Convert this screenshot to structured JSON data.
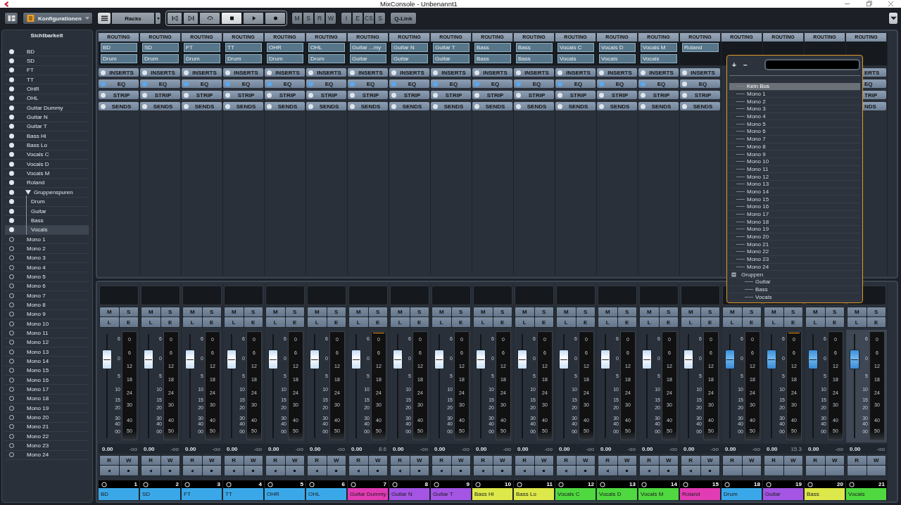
{
  "window": {
    "title": "MixConsole - Unbenannt1"
  },
  "toolbar": {
    "config_label": "Konfigurationen",
    "racks_label": "Racks",
    "qlink": "Q-Link",
    "transport": [
      {
        "kind": "start",
        "selected": false
      },
      {
        "kind": "end",
        "selected": false
      },
      {
        "kind": "cycle",
        "selected": false
      },
      {
        "kind": "stop",
        "selected": true
      },
      {
        "kind": "play",
        "selected": false
      },
      {
        "kind": "record",
        "selected": false
      }
    ],
    "group_1": [
      "M",
      "S",
      "R",
      "W"
    ],
    "group_2": [
      "I",
      "E",
      "CS",
      "S"
    ]
  },
  "visibility": {
    "title": "Sichtbarkeit",
    "items": [
      {
        "label": "BD",
        "visible": true,
        "selected": false
      },
      {
        "label": "SD",
        "visible": true,
        "selected": false
      },
      {
        "label": "FT",
        "visible": true,
        "selected": false
      },
      {
        "label": "TT",
        "visible": true,
        "selected": false
      },
      {
        "label": "OHR",
        "visible": true,
        "selected": false
      },
      {
        "label": "OHL",
        "visible": true,
        "selected": false
      },
      {
        "label": "Guitar Dummy",
        "visible": true,
        "selected": false
      },
      {
        "label": "Guitar N",
        "visible": true,
        "selected": false
      },
      {
        "label": "Guitar T",
        "visible": true,
        "selected": false
      },
      {
        "label": "Bass Hi",
        "visible": true,
        "selected": false
      },
      {
        "label": "Bass Lo",
        "visible": true,
        "selected": false
      },
      {
        "label": "Vocals C",
        "visible": true,
        "selected": false
      },
      {
        "label": "Vocals D",
        "visible": true,
        "selected": false
      },
      {
        "label": "Vocals M",
        "visible": true,
        "selected": false
      },
      {
        "label": "Roland",
        "visible": true,
        "selected": false
      },
      {
        "label": "Gruppenspuren",
        "visible": true,
        "selected": false,
        "expanded": true,
        "children": [
          {
            "label": "Drum",
            "visible": true,
            "selected": false
          },
          {
            "label": "Guitar",
            "visible": true,
            "selected": false
          },
          {
            "label": "Bass",
            "visible": true,
            "selected": false
          },
          {
            "label": "Vocals",
            "visible": true,
            "selected": true
          }
        ]
      },
      {
        "label": "Mono 1",
        "visible": false,
        "selected": false
      },
      {
        "label": "Mono 2",
        "visible": false,
        "selected": false
      },
      {
        "label": "Mono 3",
        "visible": false,
        "selected": false
      },
      {
        "label": "Mono 4",
        "visible": false,
        "selected": false
      },
      {
        "label": "Mono 5",
        "visible": false,
        "selected": false
      },
      {
        "label": "Mono 6",
        "visible": false,
        "selected": false
      },
      {
        "label": "Mono 7",
        "visible": false,
        "selected": false
      },
      {
        "label": "Mono 8",
        "visible": false,
        "selected": false
      },
      {
        "label": "Mono 9",
        "visible": false,
        "selected": false
      },
      {
        "label": "Mono 10",
        "visible": false,
        "selected": false
      },
      {
        "label": "Mono 11",
        "visible": false,
        "selected": false
      },
      {
        "label": "Mono 12",
        "visible": false,
        "selected": false
      },
      {
        "label": "Mono 13",
        "visible": false,
        "selected": false
      },
      {
        "label": "Mono 14",
        "visible": false,
        "selected": false
      },
      {
        "label": "Mono 15",
        "visible": false,
        "selected": false
      },
      {
        "label": "Mono 16",
        "visible": false,
        "selected": false
      },
      {
        "label": "Mono 17",
        "visible": false,
        "selected": false
      },
      {
        "label": "Mono 18",
        "visible": false,
        "selected": false
      },
      {
        "label": "Mono 19",
        "visible": false,
        "selected": false
      },
      {
        "label": "Mono 20",
        "visible": false,
        "selected": false
      },
      {
        "label": "Mono 21",
        "visible": false,
        "selected": false
      },
      {
        "label": "Mono 22",
        "visible": false,
        "selected": false
      },
      {
        "label": "Mono 23",
        "visible": false,
        "selected": false
      },
      {
        "label": "Mono 24",
        "visible": false,
        "selected": false
      }
    ]
  },
  "channels": [
    {
      "routing": "ROUTING",
      "input": "BD",
      "output": "Drum",
      "racks": [
        {
          "label": "INSERTS",
          "on": false
        },
        {
          "label": "EQ",
          "on": true
        },
        {
          "label": "STRIP",
          "on": false
        },
        {
          "label": "SENDS",
          "on": false
        }
      ],
      "kind": "audio",
      "buttons": [
        "M",
        "S",
        "L",
        "E"
      ],
      "automation": [
        "R",
        "W"
      ],
      "fader_scale": [
        "6",
        "0",
        "5",
        "10",
        "15",
        "20",
        "30",
        "40",
        "00"
      ],
      "meter_scale": [
        "0",
        "6",
        "12",
        "18",
        "24",
        "30",
        "40",
        "50"
      ],
      "level": 0.82,
      "gain": "0.00",
      "peak": "-oo",
      "peak_hold": false,
      "number": "1",
      "name": "BD",
      "color": "#3aa8e8",
      "selected": false
    },
    {
      "routing": "ROUTING",
      "input": "SD",
      "output": "Drum",
      "racks": [
        {
          "label": "INSERTS",
          "on": false
        },
        {
          "label": "EQ",
          "on": true
        },
        {
          "label": "STRIP",
          "on": false
        },
        {
          "label": "SENDS",
          "on": false
        }
      ],
      "kind": "audio",
      "buttons": [
        "M",
        "S",
        "L",
        "E"
      ],
      "automation": [
        "R",
        "W"
      ],
      "fader_scale": [
        "6",
        "0",
        "5",
        "10",
        "15",
        "20",
        "30",
        "40",
        "00"
      ],
      "meter_scale": [
        "0",
        "6",
        "12",
        "18",
        "24",
        "30",
        "40",
        "50"
      ],
      "level": 0.82,
      "gain": "0.00",
      "peak": "-oo",
      "peak_hold": false,
      "number": "2",
      "name": "SD",
      "color": "#3aa8e8",
      "selected": false
    },
    {
      "routing": "ROUTING",
      "input": "FT",
      "output": "Drum",
      "racks": [
        {
          "label": "INSERTS",
          "on": false
        },
        {
          "label": "EQ",
          "on": true
        },
        {
          "label": "STRIP",
          "on": false
        },
        {
          "label": "SENDS",
          "on": false
        }
      ],
      "kind": "audio",
      "buttons": [
        "M",
        "S",
        "L",
        "E"
      ],
      "automation": [
        "R",
        "W"
      ],
      "fader_scale": [
        "6",
        "0",
        "5",
        "10",
        "15",
        "20",
        "30",
        "40",
        "00"
      ],
      "meter_scale": [
        "0",
        "6",
        "12",
        "18",
        "24",
        "30",
        "40",
        "50"
      ],
      "level": 0.82,
      "gain": "0.00",
      "peak": "-oo",
      "peak_hold": false,
      "number": "3",
      "name": "FT",
      "color": "#3aa8e8",
      "selected": false
    },
    {
      "routing": "ROUTING",
      "input": "TT",
      "output": "Drum",
      "racks": [
        {
          "label": "INSERTS",
          "on": false
        },
        {
          "label": "EQ",
          "on": true
        },
        {
          "label": "STRIP",
          "on": false
        },
        {
          "label": "SENDS",
          "on": false
        }
      ],
      "kind": "audio",
      "buttons": [
        "M",
        "S",
        "L",
        "E"
      ],
      "automation": [
        "R",
        "W"
      ],
      "fader_scale": [
        "6",
        "0",
        "5",
        "10",
        "15",
        "20",
        "30",
        "40",
        "00"
      ],
      "meter_scale": [
        "0",
        "6",
        "12",
        "18",
        "24",
        "30",
        "40",
        "50"
      ],
      "level": 0.82,
      "gain": "0.00",
      "peak": "-oo",
      "peak_hold": false,
      "number": "4",
      "name": "TT",
      "color": "#3aa8e8",
      "selected": false
    },
    {
      "routing": "ROUTING",
      "input": "OHR",
      "output": "Drum",
      "racks": [
        {
          "label": "INSERTS",
          "on": false
        },
        {
          "label": "EQ",
          "on": true
        },
        {
          "label": "STRIP",
          "on": false
        },
        {
          "label": "SENDS",
          "on": false
        }
      ],
      "kind": "audio",
      "buttons": [
        "M",
        "S",
        "L",
        "E"
      ],
      "automation": [
        "R",
        "W"
      ],
      "fader_scale": [
        "6",
        "0",
        "5",
        "10",
        "15",
        "20",
        "30",
        "40",
        "00"
      ],
      "meter_scale": [
        "0",
        "6",
        "12",
        "18",
        "24",
        "30",
        "40",
        "50"
      ],
      "level": 0.82,
      "gain": "0.00",
      "peak": "-oo",
      "peak_hold": false,
      "number": "5",
      "name": "OHR",
      "color": "#3aa8e8",
      "selected": false
    },
    {
      "routing": "ROUTING",
      "input": "OHL",
      "output": "Drum",
      "racks": [
        {
          "label": "INSERTS",
          "on": false
        },
        {
          "label": "EQ",
          "on": true
        },
        {
          "label": "STRIP",
          "on": false
        },
        {
          "label": "SENDS",
          "on": false
        }
      ],
      "kind": "audio",
      "buttons": [
        "M",
        "S",
        "L",
        "E"
      ],
      "automation": [
        "R",
        "W"
      ],
      "fader_scale": [
        "6",
        "0",
        "5",
        "10",
        "15",
        "20",
        "30",
        "40",
        "00"
      ],
      "meter_scale": [
        "0",
        "6",
        "12",
        "18",
        "24",
        "30",
        "40",
        "50"
      ],
      "level": 0.82,
      "gain": "0.00",
      "peak": "-oo",
      "peak_hold": false,
      "number": "6",
      "name": "OHL",
      "color": "#3aa8e8",
      "selected": false
    },
    {
      "routing": "ROUTING",
      "input": "Guitar ...my",
      "output": "Guitar",
      "racks": [
        {
          "label": "INSERTS",
          "on": false
        },
        {
          "label": "EQ",
          "on": true
        },
        {
          "label": "STRIP",
          "on": false
        },
        {
          "label": "SENDS",
          "on": false
        }
      ],
      "kind": "audio",
      "buttons": [
        "M",
        "S",
        "L",
        "E"
      ],
      "automation": [
        "R",
        "W"
      ],
      "fader_scale": [
        "6",
        "0",
        "5",
        "10",
        "15",
        "20",
        "30",
        "40",
        "00"
      ],
      "meter_scale": [
        "0",
        "6",
        "12",
        "18",
        "24",
        "30",
        "40",
        "50"
      ],
      "level": 0.82,
      "gain": "0.00",
      "peak": "8.6",
      "peak_hold": true,
      "number": "7",
      "name": "Guitar Dummy",
      "color": "#e23cb4",
      "selected": false
    },
    {
      "routing": "ROUTING",
      "input": "Guitar N",
      "output": "Guitar",
      "racks": [
        {
          "label": "INSERTS",
          "on": false
        },
        {
          "label": "EQ",
          "on": true
        },
        {
          "label": "STRIP",
          "on": false
        },
        {
          "label": "SENDS",
          "on": false
        }
      ],
      "kind": "audio",
      "buttons": [
        "M",
        "S",
        "L",
        "E"
      ],
      "automation": [
        "R",
        "W"
      ],
      "fader_scale": [
        "6",
        "0",
        "5",
        "10",
        "15",
        "20",
        "30",
        "40",
        "00"
      ],
      "meter_scale": [
        "0",
        "6",
        "12",
        "18",
        "24",
        "30",
        "40",
        "50"
      ],
      "level": 0.82,
      "gain": "0.00",
      "peak": "-oo",
      "peak_hold": false,
      "number": "8",
      "name": "Guitar N",
      "color": "#a455e4",
      "selected": false
    },
    {
      "routing": "ROUTING",
      "input": "Guitar T",
      "output": "Guitar",
      "racks": [
        {
          "label": "INSERTS",
          "on": false
        },
        {
          "label": "EQ",
          "on": true
        },
        {
          "label": "STRIP",
          "on": false
        },
        {
          "label": "SENDS",
          "on": false
        }
      ],
      "kind": "audio",
      "buttons": [
        "M",
        "S",
        "L",
        "E"
      ],
      "automation": [
        "R",
        "W"
      ],
      "fader_scale": [
        "6",
        "0",
        "5",
        "10",
        "15",
        "20",
        "30",
        "40",
        "00"
      ],
      "meter_scale": [
        "0",
        "6",
        "12",
        "18",
        "24",
        "30",
        "40",
        "50"
      ],
      "level": 0.82,
      "gain": "0.00",
      "peak": "-oo",
      "peak_hold": false,
      "number": "9",
      "name": "Guitar T",
      "color": "#a455e4",
      "selected": false
    },
    {
      "routing": "ROUTING",
      "input": "Bass",
      "output": "Bass",
      "racks": [
        {
          "label": "INSERTS",
          "on": false
        },
        {
          "label": "EQ",
          "on": true
        },
        {
          "label": "STRIP",
          "on": false
        },
        {
          "label": "SENDS",
          "on": false
        }
      ],
      "kind": "audio",
      "buttons": [
        "M",
        "S",
        "L",
        "E"
      ],
      "automation": [
        "R",
        "W"
      ],
      "fader_scale": [
        "6",
        "0",
        "5",
        "10",
        "15",
        "20",
        "30",
        "40",
        "00"
      ],
      "meter_scale": [
        "0",
        "6",
        "12",
        "18",
        "24",
        "30",
        "40",
        "50"
      ],
      "level": 0.82,
      "gain": "0.00",
      "peak": "-oo",
      "peak_hold": false,
      "number": "10",
      "name": "Bass Hi",
      "color": "#dde84a",
      "selected": false
    },
    {
      "routing": "ROUTING",
      "input": "Bass",
      "output": "Bass",
      "racks": [
        {
          "label": "INSERTS",
          "on": false
        },
        {
          "label": "EQ",
          "on": true
        },
        {
          "label": "STRIP",
          "on": false
        },
        {
          "label": "SENDS",
          "on": false
        }
      ],
      "kind": "audio",
      "buttons": [
        "M",
        "S",
        "L",
        "E"
      ],
      "automation": [
        "R",
        "W"
      ],
      "fader_scale": [
        "6",
        "0",
        "5",
        "10",
        "15",
        "20",
        "30",
        "40",
        "00"
      ],
      "meter_scale": [
        "0",
        "6",
        "12",
        "18",
        "24",
        "30",
        "40",
        "50"
      ],
      "level": 0.82,
      "gain": "0.00",
      "peak": "-oo",
      "peak_hold": false,
      "number": "11",
      "name": "Bass Lo",
      "color": "#dde84a",
      "selected": false
    },
    {
      "routing": "ROUTING",
      "input": "Vocals C",
      "output": "Vocals",
      "racks": [
        {
          "label": "INSERTS",
          "on": false
        },
        {
          "label": "EQ",
          "on": true
        },
        {
          "label": "STRIP",
          "on": false
        },
        {
          "label": "SENDS",
          "on": false
        }
      ],
      "kind": "audio",
      "buttons": [
        "M",
        "S",
        "L",
        "E"
      ],
      "automation": [
        "R",
        "W"
      ],
      "fader_scale": [
        "6",
        "0",
        "5",
        "10",
        "15",
        "20",
        "30",
        "40",
        "00"
      ],
      "meter_scale": [
        "0",
        "6",
        "12",
        "18",
        "24",
        "30",
        "40",
        "50"
      ],
      "level": 0.82,
      "gain": "0.00",
      "peak": "-oo",
      "peak_hold": false,
      "number": "12",
      "name": "Vocals C",
      "color": "#4fd840",
      "selected": false
    },
    {
      "routing": "ROUTING",
      "input": "Vocals D",
      "output": "Vocals",
      "racks": [
        {
          "label": "INSERTS",
          "on": false
        },
        {
          "label": "EQ",
          "on": true
        },
        {
          "label": "STRIP",
          "on": false
        },
        {
          "label": "SENDS",
          "on": false
        }
      ],
      "kind": "audio",
      "buttons": [
        "M",
        "S",
        "L",
        "E"
      ],
      "automation": [
        "R",
        "W"
      ],
      "fader_scale": [
        "6",
        "0",
        "5",
        "10",
        "15",
        "20",
        "30",
        "40",
        "00"
      ],
      "meter_scale": [
        "0",
        "6",
        "12",
        "18",
        "24",
        "30",
        "40",
        "50"
      ],
      "level": 0.82,
      "gain": "0.00",
      "peak": "-oo",
      "peak_hold": false,
      "number": "13",
      "name": "Vocals D",
      "color": "#4fd840",
      "selected": false
    },
    {
      "routing": "ROUTING",
      "input": "Vocals M",
      "output": "Vocals",
      "racks": [
        {
          "label": "INSERTS",
          "on": false
        },
        {
          "label": "EQ",
          "on": true
        },
        {
          "label": "STRIP",
          "on": false
        },
        {
          "label": "SENDS",
          "on": false
        }
      ],
      "kind": "audio",
      "buttons": [
        "M",
        "S",
        "L",
        "E"
      ],
      "automation": [
        "R",
        "W"
      ],
      "fader_scale": [
        "6",
        "0",
        "5",
        "10",
        "15",
        "20",
        "30",
        "40",
        "00"
      ],
      "meter_scale": [
        "0",
        "6",
        "12",
        "18",
        "24",
        "30",
        "40",
        "50"
      ],
      "level": 0.82,
      "gain": "0.00",
      "peak": "-oo",
      "peak_hold": false,
      "number": "14",
      "name": "Vocals M",
      "color": "#4fd840",
      "selected": false
    },
    {
      "routing": "ROUTING",
      "input": "Roland",
      "racks": [
        {
          "label": "INSERTS",
          "on": false
        },
        {
          "label": "EQ",
          "on": false
        },
        {
          "label": "STRIP",
          "on": false
        },
        {
          "label": "SENDS",
          "on": false
        }
      ],
      "kind": "audio",
      "buttons": [
        "M",
        "S",
        "L",
        "E"
      ],
      "automation": [
        "R",
        "W"
      ],
      "fader_scale": [
        "6",
        "0",
        "5",
        "10",
        "15",
        "20",
        "30",
        "40",
        "00"
      ],
      "meter_scale": [
        "0",
        "6",
        "12",
        "18",
        "24",
        "30",
        "40",
        "50"
      ],
      "level": 0.82,
      "gain": "0.00",
      "peak": "-oo",
      "peak_hold": false,
      "number": "15",
      "name": "Roland",
      "color": "#e23cb4",
      "selected": false
    },
    {
      "routing": "ROUTING",
      "kind": "group",
      "buttons": [
        "M",
        "S",
        "L",
        "E"
      ],
      "automation": [
        "R",
        "W"
      ],
      "fader_scale": [
        "6",
        "0",
        "5",
        "10",
        "15",
        "20",
        "30",
        "40",
        "00"
      ],
      "meter_scale": [
        "0",
        "6",
        "12",
        "18",
        "24",
        "30",
        "40",
        "50"
      ],
      "level": 0.82,
      "gain": "0.00",
      "peak": "-oo",
      "peak_hold": false,
      "number": "18",
      "name": "Drum",
      "color": "#3aa8e8",
      "selected": false
    },
    {
      "routing": "ROUTING",
      "kind": "group",
      "buttons": [
        "M",
        "S",
        "L",
        "E"
      ],
      "automation": [
        "R",
        "W"
      ],
      "fader_scale": [
        "6",
        "0",
        "5",
        "10",
        "15",
        "20",
        "30",
        "40",
        "00"
      ],
      "meter_scale": [
        "0",
        "6",
        "12",
        "18",
        "24",
        "30",
        "40",
        "50"
      ],
      "level": 0.82,
      "gain": "0.00",
      "peak": "15.3",
      "peak_hold": true,
      "number": "19",
      "name": "Guitar",
      "color": "#a455e4",
      "selected": false
    },
    {
      "routing": "ROUTING",
      "kind": "group",
      "buttons": [
        "M",
        "S",
        "L",
        "E"
      ],
      "automation": [
        "R",
        "W"
      ],
      "fader_scale": [
        "6",
        "0",
        "5",
        "10",
        "15",
        "20",
        "30",
        "40",
        "00"
      ],
      "meter_scale": [
        "0",
        "6",
        "12",
        "18",
        "24",
        "30",
        "40",
        "50"
      ],
      "level": 0.82,
      "gain": "0.00",
      "peak": "-oo",
      "peak_hold": false,
      "number": "20",
      "name": "Bass",
      "color": "#dde84a",
      "selected": false
    },
    {
      "routing": "ROUTING",
      "racks": [
        {
          "label": "ERTS"
        },
        {
          "label": "EQ"
        },
        {
          "label": "TRIP"
        },
        {
          "label": "NDS"
        }
      ],
      "kind": "group",
      "buttons": [
        "M",
        "S",
        "L",
        "E"
      ],
      "automation": [
        "R",
        "W"
      ],
      "fader_scale": [
        "6",
        "0",
        "5",
        "10",
        "15",
        "20",
        "30",
        "40",
        "00"
      ],
      "meter_scale": [
        "0",
        "6",
        "12",
        "18",
        "24",
        "30",
        "40",
        "50"
      ],
      "level": 0.82,
      "gain": "0.00",
      "peak": "-oo",
      "peak_hold": false,
      "number": "21",
      "name": "Vocals",
      "color": "#4fd840",
      "selected": true
    }
  ],
  "bus_popup": {
    "add": "+",
    "remove": "−",
    "items": [
      {
        "label": "Kein Bus",
        "selected": true
      },
      {
        "label": "Mono 1",
        "selected": false
      },
      {
        "label": "Mono 2",
        "selected": false
      },
      {
        "label": "Mono 3",
        "selected": false
      },
      {
        "label": "Mono 4",
        "selected": false
      },
      {
        "label": "Mono 5",
        "selected": false
      },
      {
        "label": "Mono 6",
        "selected": false
      },
      {
        "label": "Mono 7",
        "selected": false
      },
      {
        "label": "Mono 8",
        "selected": false
      },
      {
        "label": "Mono 9",
        "selected": false
      },
      {
        "label": "Mono 10",
        "selected": false
      },
      {
        "label": "Mono 11",
        "selected": false
      },
      {
        "label": "Mono 12",
        "selected": false
      },
      {
        "label": "Mono 13",
        "selected": false
      },
      {
        "label": "Mono 14",
        "selected": false
      },
      {
        "label": "Mono 15",
        "selected": false
      },
      {
        "label": "Mono 16",
        "selected": false
      },
      {
        "label": "Mono 17",
        "selected": false
      },
      {
        "label": "Mono 18",
        "selected": false
      },
      {
        "label": "Mono 19",
        "selected": false
      },
      {
        "label": "Mono 20",
        "selected": false
      },
      {
        "label": "Mono 21",
        "selected": false
      },
      {
        "label": "Mono 22",
        "selected": false
      },
      {
        "label": "Mono 23",
        "selected": false
      },
      {
        "label": "Mono 24",
        "selected": false
      },
      {
        "label": "Gruppen",
        "selected": false,
        "expanded": true,
        "children": [
          {
            "label": "Guitar",
            "selected": false
          },
          {
            "label": "Bass",
            "selected": false
          },
          {
            "label": "Vocals",
            "selected": false
          }
        ]
      }
    ]
  }
}
